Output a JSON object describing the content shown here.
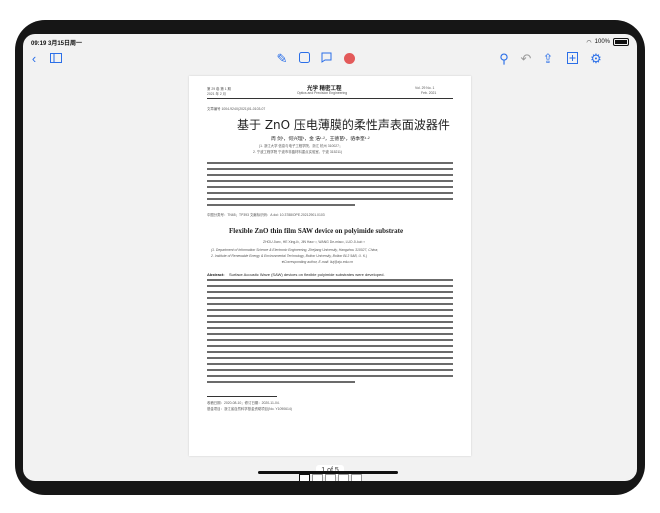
{
  "status_bar": {
    "time_date": "09:19  3月15日周一",
    "battery": "100%"
  },
  "toolbar": {
    "back_icon": "chevron-left-icon",
    "sidebar_icon": "sidebar-icon",
    "pen_icon": "pen-icon",
    "lasso_icon": "shape-icon",
    "comment_icon": "comment-icon",
    "record_color": "#e35a5a",
    "search_icon": "search-icon",
    "undo_icon": "undo-icon",
    "redo_icon": "redo-icon",
    "share_icon": "share-icon",
    "add_icon": "add-page-icon",
    "settings_icon": "settings-icon"
  },
  "document": {
    "header_left_1": "第 29 卷  第 1 期",
    "header_left_2": "2021 年 2 月",
    "header_center_1": "光学 精密工程",
    "header_center_2": "Optics and Precision Engineering",
    "header_right_1": "Vol. 29   No. 1",
    "header_right_2": "Feb. 2021",
    "article_code": "文章编号  1004-924X(2021)01-0103-07",
    "title_cn": "基于 ZnO 压电薄膜的柔性声表面波器件",
    "authors_cn": "周  剑¹，何兴理¹，金  浩¹·²，王德苗¹，骆季奎¹·²",
    "affil_cn_1": "(1. 浙江大学 信息与电子工程学院，浙江 杭州 310027；",
    "affil_cn_2": "2. 宁波工程学院 宁波市非晶材料重点实验室，宁波 315211)",
    "cn_class": "中图分类号：TN65；TP393      文献标识码：A      doi: 10.3788/OPE.20212901.0103",
    "title_en": "Flexible ZnO thin film SAW device on polyimide substrate",
    "authors_en": "ZHOU Jian¹, HE Xing-li¹, JIN Hao¹·², WANG De-miao¹, LUO Ji-kui¹·²",
    "affil_en_1": "(1. Department of Information Science & Electronic Engineering, Zhejiang University, Hangzhou 310027, China;",
    "affil_en_2": "2. Institute of Renewable Energy & Environmental Technology, Bolton University, Bolton BL3 5AB, U. K.)",
    "affil_en_3": "★Corresponding author, E-mail: liuj@zju.edu.cn",
    "abstract_label": "Abstract:",
    "abstract_start": "Surface Acoustic Wave (SAW) devices on flexible polyimide substrates were developed.",
    "footnote_1": "收稿日期：2020-08-10；修订日期：2020-11-04.",
    "footnote_2": "基金项目：浙江省自然科学基金资助项目(No. Y1090614)"
  },
  "page_indicator": "1 of 5"
}
